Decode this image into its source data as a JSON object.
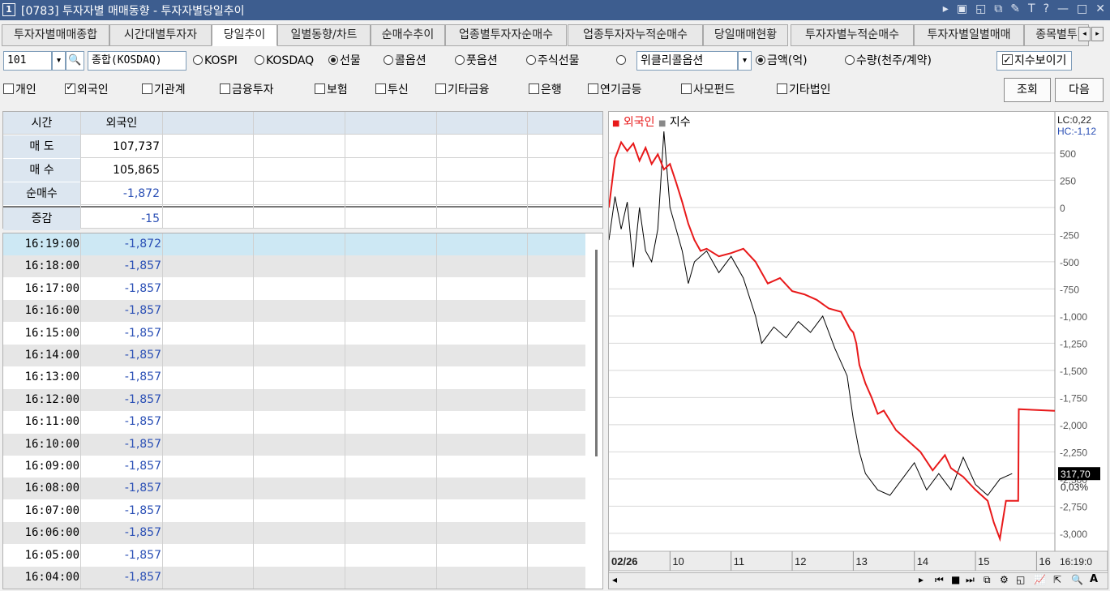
{
  "window": {
    "number": "1",
    "title": "[0783] 투자자별 매매동향 - 투자자별당일추이",
    "controls": [
      "▸",
      "▣",
      "◱",
      "⧉",
      "✎",
      "T",
      "?",
      "—",
      "□",
      "✕"
    ]
  },
  "tabs": [
    {
      "label": "투자자별매매종합",
      "active": false
    },
    {
      "label": "시간대별투자자",
      "active": false
    },
    {
      "label": "당일추이",
      "active": true
    },
    {
      "label": "일별동향/차트",
      "active": false
    },
    {
      "label": "순매수추이",
      "active": false
    },
    {
      "label": "업종별투자자순매수",
      "active": false
    },
    {
      "label": "업종투자자누적순매수",
      "active": false
    },
    {
      "label": "당일매매현황",
      "active": false
    },
    {
      "label": "투자자별누적순매수",
      "active": false
    },
    {
      "label": "투자자별일별매매",
      "active": false
    },
    {
      "label": "종목별투",
      "active": false
    }
  ],
  "options": {
    "code_value": "101",
    "market_value": "종합(KOSDAQ)",
    "radios": [
      {
        "label": "KOSPI",
        "on": false
      },
      {
        "label": "KOSDAQ",
        "on": false
      },
      {
        "label": "선물",
        "on": true
      },
      {
        "label": "콜옵션",
        "on": false
      },
      {
        "label": "풋옵션",
        "on": false
      },
      {
        "label": "주식선물",
        "on": false
      },
      {
        "label": "",
        "on": false
      }
    ],
    "weekly_select": "위클리콜옵션",
    "unit_radios": [
      {
        "label": "금액(억)",
        "on": true
      },
      {
        "label": "수량(천주/계약)",
        "on": false
      }
    ],
    "show_index_label": "지수보이기"
  },
  "investors": [
    {
      "label": "개인",
      "on": false
    },
    {
      "label": "외국인",
      "on": true
    },
    {
      "label": "기관계",
      "on": false
    },
    {
      "label": "금융투자",
      "on": false
    },
    {
      "label": "보험",
      "on": false
    },
    {
      "label": "투신",
      "on": false
    },
    {
      "label": "기타금융",
      "on": false
    },
    {
      "label": "은행",
      "on": false
    },
    {
      "label": "연기금등",
      "on": false
    },
    {
      "label": "사모펀드",
      "on": false
    },
    {
      "label": "기타법인",
      "on": false
    }
  ],
  "buttons": {
    "query": "조회",
    "next": "다음"
  },
  "summary": {
    "headers": [
      "시간",
      "외국인"
    ],
    "rows": [
      {
        "label": "매 도",
        "value": "107,737",
        "color": "#000000"
      },
      {
        "label": "매 수",
        "value": "105,865",
        "color": "#000000"
      },
      {
        "label": "순매수",
        "value": "-1,872",
        "color": "#2a4fb5"
      },
      {
        "label": "증감",
        "value": "-15",
        "color": "#2a4fb5"
      }
    ]
  },
  "time_rows": [
    {
      "time": "16:19:00",
      "value": "-1,872"
    },
    {
      "time": "16:18:00",
      "value": "-1,857"
    },
    {
      "time": "16:17:00",
      "value": "-1,857"
    },
    {
      "time": "16:16:00",
      "value": "-1,857"
    },
    {
      "time": "16:15:00",
      "value": "-1,857"
    },
    {
      "time": "16:14:00",
      "value": "-1,857"
    },
    {
      "time": "16:13:00",
      "value": "-1,857"
    },
    {
      "time": "16:12:00",
      "value": "-1,857"
    },
    {
      "time": "16:11:00",
      "value": "-1,857"
    },
    {
      "time": "16:10:00",
      "value": "-1,857"
    },
    {
      "time": "16:09:00",
      "value": "-1,857"
    },
    {
      "time": "16:08:00",
      "value": "-1,857"
    },
    {
      "time": "16:07:00",
      "value": "-1,857"
    },
    {
      "time": "16:06:00",
      "value": "-1,857"
    },
    {
      "time": "16:05:00",
      "value": "-1,857"
    },
    {
      "time": "16:04:00",
      "value": "-1,857"
    }
  ],
  "chart_data": {
    "type": "line",
    "legend": [
      "외국인",
      "지수"
    ],
    "series_colors": [
      "#e8191a",
      "#000000"
    ],
    "y_ticks": [
      "500",
      "250",
      "0",
      "-250",
      "-500",
      "-750",
      "-1,000",
      "-1,250",
      "-1,500",
      "-1,750",
      "-2,000",
      "-2,250",
      "-2,500",
      "-2,750",
      "-3,000"
    ],
    "y_tick_values": [
      500,
      250,
      0,
      -250,
      -500,
      -750,
      -1000,
      -1250,
      -1500,
      -1750,
      -2000,
      -2250,
      -2500,
      -2750,
      -3000
    ],
    "ylim": [
      -3150,
      880
    ],
    "x_ticks": [
      "02/26",
      "10",
      "11",
      "12",
      "13",
      "14",
      "15",
      "16"
    ],
    "x_tick_values": [
      9,
      10,
      11,
      12,
      13,
      14,
      15,
      16
    ],
    "xlim": [
      9,
      16.3
    ],
    "corner_labels": [
      "LC:0,22",
      "HC:-1,12"
    ],
    "time_label": "16:19:0",
    "current_value_label": "317,70",
    "current_change_label": "0,03%",
    "foreign": [
      [
        9.0,
        0
      ],
      [
        9.1,
        450
      ],
      [
        9.2,
        600
      ],
      [
        9.3,
        520
      ],
      [
        9.4,
        590
      ],
      [
        9.5,
        430
      ],
      [
        9.6,
        550
      ],
      [
        9.7,
        400
      ],
      [
        9.8,
        490
      ],
      [
        9.9,
        350
      ],
      [
        10.0,
        400
      ],
      [
        10.1,
        230
      ],
      [
        10.2,
        50
      ],
      [
        10.3,
        -150
      ],
      [
        10.4,
        -300
      ],
      [
        10.5,
        -400
      ],
      [
        10.6,
        -380
      ],
      [
        10.8,
        -450
      ],
      [
        11.0,
        -420
      ],
      [
        11.2,
        -380
      ],
      [
        11.4,
        -500
      ],
      [
        11.6,
        -700
      ],
      [
        11.8,
        -650
      ],
      [
        12.0,
        -770
      ],
      [
        12.2,
        -800
      ],
      [
        12.4,
        -850
      ],
      [
        12.6,
        -930
      ],
      [
        12.8,
        -960
      ],
      [
        12.95,
        -1120
      ],
      [
        13.0,
        -1150
      ],
      [
        13.05,
        -1250
      ],
      [
        13.1,
        -1450
      ],
      [
        13.2,
        -1620
      ],
      [
        13.3,
        -1750
      ],
      [
        13.4,
        -1900
      ],
      [
        13.5,
        -1870
      ],
      [
        13.7,
        -2050
      ],
      [
        13.9,
        -2150
      ],
      [
        14.1,
        -2250
      ],
      [
        14.3,
        -2420
      ],
      [
        14.5,
        -2280
      ],
      [
        14.6,
        -2400
      ],
      [
        14.8,
        -2480
      ],
      [
        15.0,
        -2600
      ],
      [
        15.2,
        -2700
      ],
      [
        15.3,
        -2900
      ],
      [
        15.4,
        -3050
      ],
      [
        15.5,
        -2700
      ],
      [
        15.7,
        -2700
      ],
      [
        15.71,
        -1857
      ],
      [
        16.3,
        -1872
      ]
    ],
    "index": [
      [
        9.0,
        -300
      ],
      [
        9.1,
        100
      ],
      [
        9.2,
        -200
      ],
      [
        9.3,
        50
      ],
      [
        9.4,
        -550
      ],
      [
        9.5,
        0
      ],
      [
        9.6,
        -400
      ],
      [
        9.7,
        -500
      ],
      [
        9.8,
        -200
      ],
      [
        9.9,
        700
      ],
      [
        10.0,
        0
      ],
      [
        10.1,
        -200
      ],
      [
        10.2,
        -400
      ],
      [
        10.3,
        -700
      ],
      [
        10.4,
        -500
      ],
      [
        10.6,
        -400
      ],
      [
        10.8,
        -600
      ],
      [
        11.0,
        -450
      ],
      [
        11.2,
        -650
      ],
      [
        11.4,
        -1000
      ],
      [
        11.5,
        -1250
      ],
      [
        11.7,
        -1100
      ],
      [
        11.9,
        -1200
      ],
      [
        12.1,
        -1050
      ],
      [
        12.3,
        -1150
      ],
      [
        12.5,
        -1000
      ],
      [
        12.7,
        -1300
      ],
      [
        12.9,
        -1550
      ],
      [
        13.0,
        -1950
      ],
      [
        13.1,
        -2250
      ],
      [
        13.2,
        -2450
      ],
      [
        13.4,
        -2600
      ],
      [
        13.6,
        -2650
      ],
      [
        13.8,
        -2500
      ],
      [
        14.0,
        -2350
      ],
      [
        14.2,
        -2600
      ],
      [
        14.4,
        -2450
      ],
      [
        14.6,
        -2600
      ],
      [
        14.8,
        -2300
      ],
      [
        15.0,
        -2550
      ],
      [
        15.2,
        -2650
      ],
      [
        15.4,
        -2500
      ],
      [
        15.6,
        -2450
      ]
    ]
  }
}
